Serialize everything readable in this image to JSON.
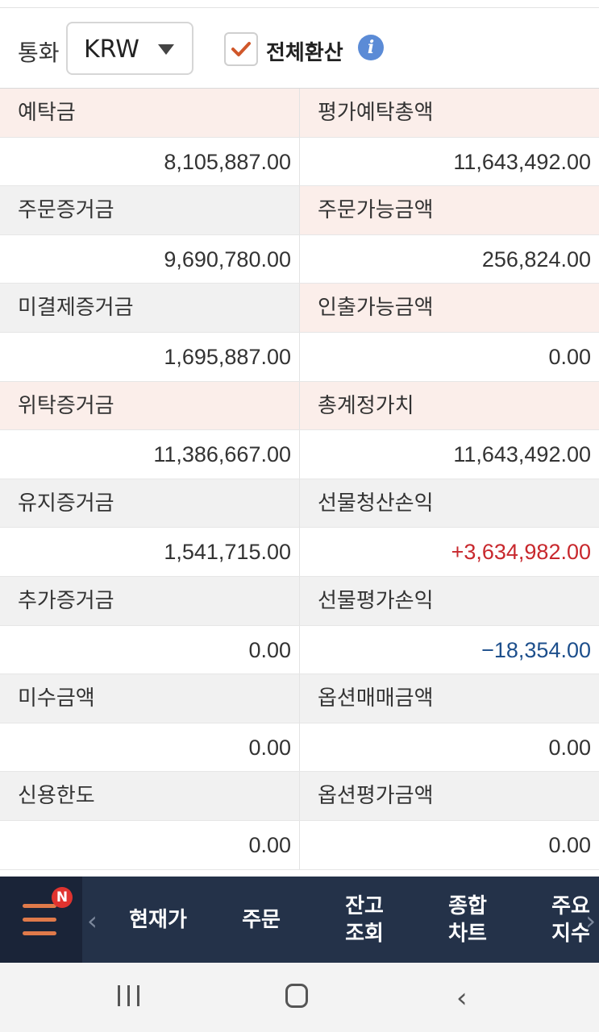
{
  "controls": {
    "currency_label": "통화",
    "currency_value": "KRW",
    "convert_all_label": "전체환산",
    "convert_all_checked": true,
    "info_icon": "i"
  },
  "rows": [
    {
      "left_label": "예탁금",
      "right_label": "평가예탁총액",
      "left_value": "8,105,887.00",
      "right_value": "11,643,492.00"
    },
    {
      "left_label": "주문증거금",
      "right_label": "주문가능금액",
      "left_value": "9,690,780.00",
      "right_value": "256,824.00"
    },
    {
      "left_label": "미결제증거금",
      "right_label": "인출가능금액",
      "left_value": "1,695,887.00",
      "right_value": "0.00"
    },
    {
      "left_label": "위탁증거금",
      "right_label": "총계정가치",
      "left_value": "11,386,667.00",
      "right_value": "11,643,492.00"
    },
    {
      "left_label": "유지증거금",
      "right_label": "선물청산손익",
      "left_value": "1,541,715.00",
      "right_value": "+3,634,982.00"
    },
    {
      "left_label": "추가증거금",
      "right_label": "선물평가손익",
      "left_value": "0.00",
      "right_value": "−18,354.00"
    },
    {
      "left_label": "미수금액",
      "right_label": "옵션매매금액",
      "left_value": "0.00",
      "right_value": "0.00"
    },
    {
      "left_label": "신용한도",
      "right_label": "옵션평가금액",
      "left_value": "0.00",
      "right_value": "0.00"
    }
  ],
  "colors": {
    "positive": "#c8282d",
    "negative": "#1d4f8c",
    "label_bg": "#f1f1f1",
    "label_bg_highlight": "#fbeeea",
    "nav_bg": "#243249",
    "accent": "#e07a4a"
  },
  "nav": {
    "menu_icon": "hamburger-icon",
    "badge": "N",
    "left_arrow": "‹",
    "right_arrow": "›",
    "items": [
      {
        "label": "현재가"
      },
      {
        "label": "주문"
      },
      {
        "label": "잔고\n조회"
      },
      {
        "label": "종합\n차트"
      },
      {
        "label": "주요\n지수"
      }
    ]
  },
  "system_nav": {
    "recent_icon": "recent-apps-icon",
    "home_icon": "home-icon",
    "back_icon": "back-icon",
    "back_glyph": "‹"
  }
}
